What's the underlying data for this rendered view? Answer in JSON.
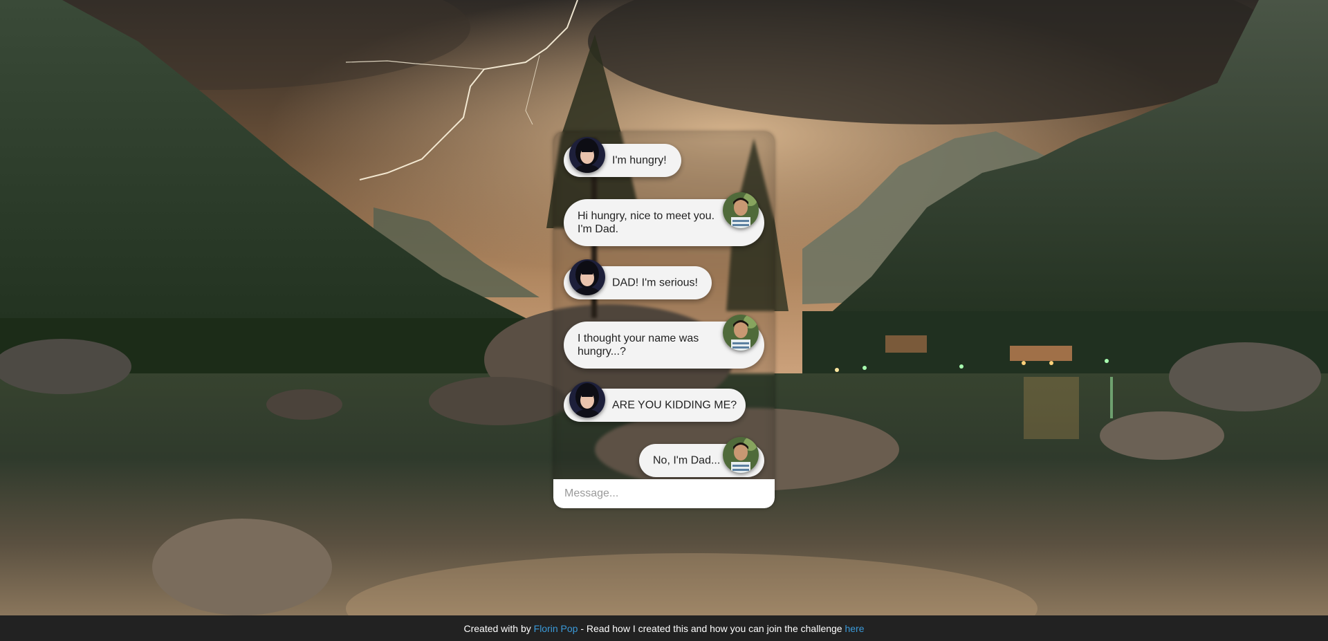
{
  "chat": {
    "messages": [
      {
        "sender": "daughter",
        "text": "I'm hungry!"
      },
      {
        "sender": "dad",
        "text": "Hi hungry, nice to meet you. I'm Dad."
      },
      {
        "sender": "daughter",
        "text": "DAD! I'm serious!"
      },
      {
        "sender": "dad",
        "text": "I thought your name was hungry...?"
      },
      {
        "sender": "daughter",
        "text": "ARE YOU KIDDING ME?"
      },
      {
        "sender": "dad",
        "text": "No, I'm Dad..."
      }
    ],
    "input_placeholder": "Message..."
  },
  "footer": {
    "prefix": "Created with by ",
    "author_link": "Florin Pop",
    "middle": " - Read how I created this and how you can join the challenge ",
    "here_link": "here"
  },
  "colors": {
    "link": "#3b9ad9",
    "footer_bg": "#222222",
    "bubble": "#f3f3f3"
  },
  "icons": {
    "daughter_avatar": "avatar-daughter-icon",
    "dad_avatar": "avatar-dad-icon"
  }
}
